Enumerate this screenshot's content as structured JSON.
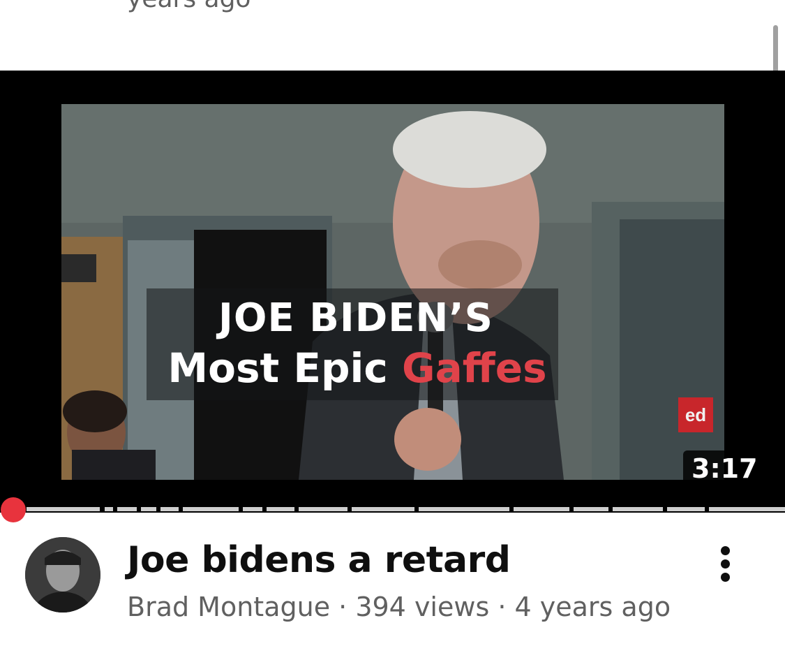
{
  "previous_item": {
    "meta_text": "years ago"
  },
  "player": {
    "overlay_title": {
      "line1": "JOE BIDEN’S",
      "line2_prefix": "Most Epic ",
      "line2_highlight": "Gaffes"
    },
    "channel_logo": "ed",
    "duration": "3:17",
    "progress_fraction": 0.0
  },
  "video": {
    "title": "Joe bidens a retard",
    "channel": "Brad Montague",
    "views": "394 views",
    "age": "4 years ago",
    "separator": " · "
  },
  "icons": {
    "more": "more-vertical-icon",
    "avatar": "channel-avatar"
  },
  "colors": {
    "progress_dot": "#e8333d",
    "title_highlight": "#e0434a",
    "title_text": "#0f0f0f",
    "meta_text": "#606060"
  }
}
